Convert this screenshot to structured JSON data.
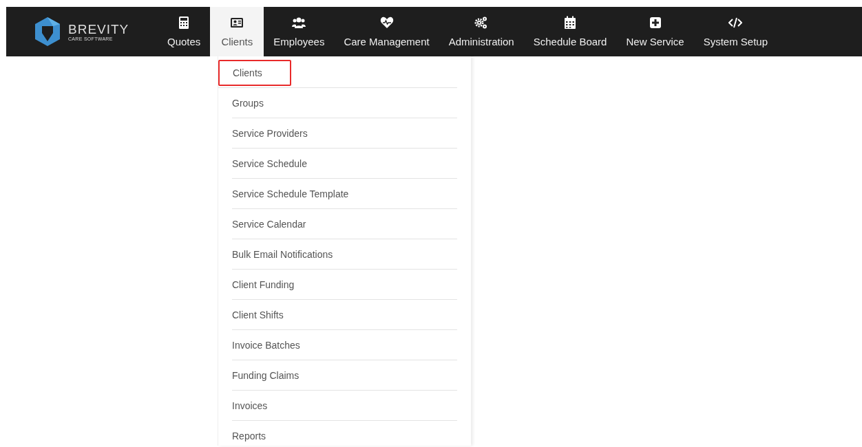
{
  "brand": {
    "name": "BREVITY",
    "tagline": "CARE SOFTWARE"
  },
  "nav": [
    {
      "label": "Quotes",
      "kind": "calculator",
      "selected": false
    },
    {
      "label": "Clients",
      "kind": "idcard",
      "selected": true
    },
    {
      "label": "Employees",
      "kind": "users",
      "selected": false
    },
    {
      "label": "Care Management",
      "kind": "heart",
      "selected": false
    },
    {
      "label": "Administration",
      "kind": "cogs",
      "selected": false
    },
    {
      "label": "Schedule Board",
      "kind": "calendar",
      "selected": false
    },
    {
      "label": "New Service",
      "kind": "plus",
      "selected": false
    },
    {
      "label": "System Setup",
      "kind": "code",
      "selected": false
    }
  ],
  "menu": [
    {
      "label": "Clients",
      "highlighted": true
    },
    {
      "label": "Groups",
      "highlighted": false
    },
    {
      "label": "Service Providers",
      "highlighted": false
    },
    {
      "label": "Service Schedule",
      "highlighted": false
    },
    {
      "label": "Service Schedule Template",
      "highlighted": false
    },
    {
      "label": "Service Calendar",
      "highlighted": false
    },
    {
      "label": "Bulk Email Notifications",
      "highlighted": false
    },
    {
      "label": "Client Funding",
      "highlighted": false
    },
    {
      "label": "Client Shifts",
      "highlighted": false
    },
    {
      "label": "Invoice Batches",
      "highlighted": false
    },
    {
      "label": "Funding Claims",
      "highlighted": false
    },
    {
      "label": "Invoices",
      "highlighted": false
    },
    {
      "label": "Reports",
      "highlighted": false
    }
  ]
}
